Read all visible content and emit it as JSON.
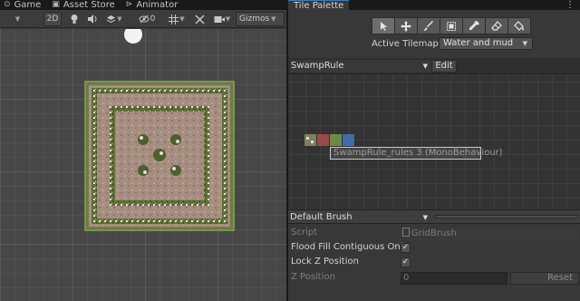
{
  "scene_tabs": [
    {
      "icon": "game-controller-icon",
      "glyph": "⊙",
      "label": "Game"
    },
    {
      "icon": "asset-store-icon",
      "glyph": "▣",
      "label": "Asset Store"
    },
    {
      "icon": "animator-icon",
      "glyph": "⊳",
      "label": "Animator"
    }
  ],
  "scene_toolbar": {
    "mode_2d_label": "2D",
    "hidden_count": "0",
    "gizmos_label": "Gizmos"
  },
  "palette": {
    "tab_title": "Tile Palette",
    "active_tilemap_label": "Active Tilemap",
    "active_tilemap_value": "Water and mud",
    "selected_palette": "SwampRule",
    "edit_label": "Edit",
    "tile_tooltip": "SwampRule_rules 3 (MonoBehaviour)",
    "tools": [
      "select-tool-icon",
      "move-tool-icon",
      "paint-brush-tool-icon",
      "box-fill-tool-icon",
      "picker-tool-icon",
      "eraser-tool-icon",
      "flood-fill-tool-icon"
    ],
    "swatch_colors": [
      "#8b8b6a",
      "#9a4a4a",
      "#6d8a45",
      "#3e6da8"
    ]
  },
  "brush": {
    "selected": "Default Brush",
    "script_label": "Script",
    "script_value": "GridBrush",
    "flood_fill_label": "Flood Fill Contiguous Only",
    "flood_fill_checked": true,
    "lock_z_label": "Lock Z Position",
    "lock_z_checked": true,
    "z_position_label": "Z Position",
    "z_position_value": "0",
    "reset_label": "Reset"
  },
  "colors": {
    "accent": "#3a79bb",
    "scene_background": "#474747",
    "panel_background": "#383838"
  }
}
